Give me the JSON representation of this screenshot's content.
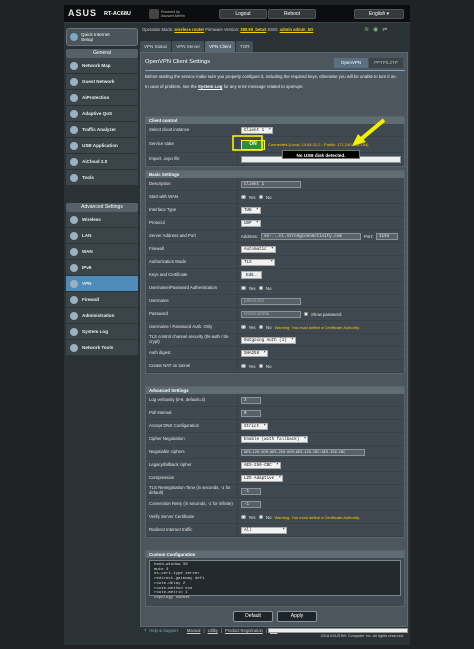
{
  "header": {
    "brand": "ASUS",
    "model": "RT-AC68U",
    "powered_by": "Powered by",
    "powered_by_company": "Asuswrt-Merlin",
    "logout": "Logout",
    "reboot": "Reboot",
    "language": "English"
  },
  "status_bar": {
    "op_mode_label": "Operation Mode:",
    "op_mode_value": "wireless router",
    "firmware_label": "Firmware Version:",
    "firmware_value": "380.59_beta3",
    "ssid_label": "SSID:",
    "ssid_value": "admin  admin_5G"
  },
  "sidebar": {
    "qis": "Quick Internet Setup",
    "general_header": "General",
    "general_items": [
      "Network Map",
      "Guest Network",
      "AiProtection",
      "Adaptive QoS",
      "Traffic Analyzer",
      "USB Application",
      "AiCloud 2.0",
      "Tools"
    ],
    "advanced_header": "Advanced Settings",
    "advanced_items": [
      "Wireless",
      "LAN",
      "WAN",
      "IPv6",
      "VPN",
      "Firewall",
      "Administration",
      "System Log",
      "Network Tools"
    ]
  },
  "tabs": [
    "VPN Status",
    "VPN Server",
    "VPN Client",
    "TOR"
  ],
  "main": {
    "title": "OpenVPN Client Settings",
    "subtabs": [
      "OpenVPN",
      "PPTP/L2TP"
    ],
    "intro1": "Before starting the service make sure you properly configure it, including the required keys, otherwise you will be unable to turn it on.",
    "intro2a": "In case of problem, see the ",
    "intro2link": "System Log",
    "intro2b": " for any error message related to openvpn."
  },
  "client_control": {
    "header": "Client control",
    "rows": [
      {
        "label": "Select client instance",
        "value": "Client 1"
      },
      {
        "label": "Service state",
        "value": "ON",
        "note": "Connected (Local: 10.64.12.2 - Public: 171.240.228.154)"
      },
      {
        "label": "Import .ovpn file",
        "value": ""
      }
    ],
    "callout": "No USB disk detected."
  },
  "basic": {
    "header": "Basic Settings",
    "rows": [
      {
        "label": "Description",
        "value": "Client 1"
      },
      {
        "label": "Start with WAN",
        "yes": "Yes",
        "no": "No"
      },
      {
        "label": "Interface Type",
        "value": "TUN"
      },
      {
        "label": "Protocol",
        "value": "UDP"
      },
      {
        "label": "Server Address and Port",
        "addr_label": "Address:",
        "addr": "vn-...nl.strongconnectivity.com",
        "port_label": "Port:",
        "port": "1194"
      },
      {
        "label": "Firewall",
        "value": "Automatic"
      },
      {
        "label": "Authorization Mode",
        "value": "TLS"
      },
      {
        "label": "Keys and Certificate",
        "button": "Edit..."
      },
      {
        "label": "Username/Password Authentication",
        "yes": "Yes",
        "no": "No"
      },
      {
        "label": "Username",
        "value": "p8041422"
      },
      {
        "label": "Password",
        "value": "Wnb5kq0d9m",
        "show": "Show password"
      },
      {
        "label": "Username / Password Auth. Only",
        "yes": "Yes",
        "no": "No",
        "warning": "Warning: You must define a Certificate Authority."
      },
      {
        "label": "TLS control channel security (tls-auth / tls-crypt)",
        "value": "Outgoing Auth (1)"
      },
      {
        "label": "Auth digest",
        "value": "SHA256"
      },
      {
        "label": "Create NAT on tunnel",
        "yes": "Yes",
        "no": "No"
      }
    ]
  },
  "advanced": {
    "header": "Advanced Settings",
    "rows": [
      {
        "label": "Log verbosity (0-6, default=3)",
        "value": "3"
      },
      {
        "label": "Poll Interval",
        "value": "0"
      },
      {
        "label": "Accept DNS Configuration",
        "value": "Strict"
      },
      {
        "label": "Cipher Negotiation",
        "value": "Enable (with fallback)"
      },
      {
        "label": "Negotiable ciphers",
        "value": "AES-128-GCM:AES-256-GCM:AES-128-CBC:AES-256-CBC"
      },
      {
        "label": "Legacy/fallback cipher",
        "value": "AES-256-CBC"
      },
      {
        "label": "Compression",
        "value": "LZO Adaptive"
      },
      {
        "label": "TLS Renegotiation Time (in seconds, -1 for default)",
        "value": "-1"
      },
      {
        "label": "Connection Retry (in seconds, -1 for infinite)",
        "value": "-1"
      },
      {
        "label": "Verify Server Certificate",
        "yes": "Yes",
        "no": "No",
        "warning": "Warning: You must define a Certificate Authority."
      },
      {
        "label": "Redirect Internet traffic",
        "value": "All"
      }
    ]
  },
  "custom": {
    "header": "Custom Configuration",
    "text": "hand-window 30\nmute 3\nns-cert-type server\nredirect-gateway def1\nroute-delay 2\nroute-method exe\nroute-metric 1\ntopology subnet"
  },
  "buttons": {
    "default": "Default",
    "apply": "Apply"
  },
  "footer": {
    "help": "Help & Support",
    "manual": "Manual",
    "utility": "Utility",
    "product_reg": "Product Registration",
    "app": "App",
    "copyright": "2018 ASUSTeK Computer Inc. All rights reserved."
  }
}
